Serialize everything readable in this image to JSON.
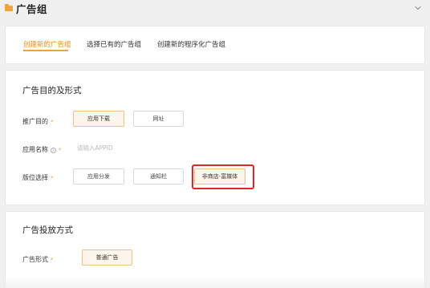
{
  "header": {
    "title": "广告组"
  },
  "tabs": [
    {
      "label": "创建新的广告组",
      "active": true
    },
    {
      "label": "选择已有的广告组",
      "active": false
    },
    {
      "label": "创建新的程序化广告组",
      "active": false
    }
  ],
  "section_goal": {
    "title": "广告目的及形式",
    "promo_label": "推广目的",
    "promo_options": [
      "应用下载",
      "网址"
    ],
    "promo_selected": "应用下载",
    "app_name_label": "应用名称",
    "app_name_placeholder": "请输入APPID",
    "placement_label": "版位选择",
    "placement_options": [
      "应用分发",
      "通知栏",
      "非商店-富媒体"
    ],
    "placement_selected": "非商店-富媒体",
    "required_mark": "*"
  },
  "section_delivery": {
    "title": "广告投放方式",
    "format_label": "广告形式",
    "format_options": [
      "普通广告"
    ],
    "format_selected": "普通广告",
    "required_mark": "*"
  },
  "colors": {
    "accent": "#f0a33b",
    "active_tab_text": "#e88a1a",
    "selected_bg": "#fdf6ec",
    "selected_border": "#edc089",
    "highlight_box": "#d9292b"
  },
  "icons": [
    "folder-icon",
    "chevron-down-icon",
    "info-icon"
  ]
}
